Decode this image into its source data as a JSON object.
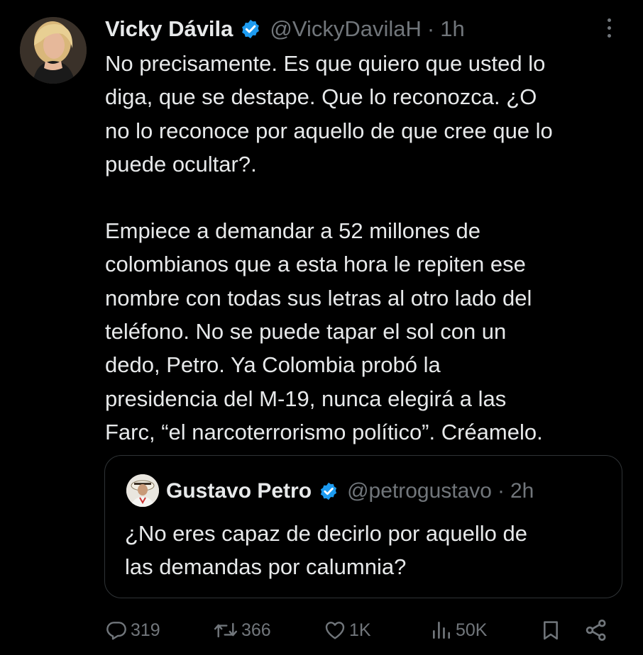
{
  "tweet": {
    "author_name": "Vicky Dávila",
    "handle": "@VickyDavilaH",
    "separator": "·",
    "time": "1h",
    "paragraph1_lines": [
      "No precisamente. Es que quiero que usted lo",
      "diga, que se destape. Que lo reconozca. ¿O",
      "no lo reconoce por aquello de que cree que lo",
      "puede ocultar?."
    ],
    "paragraph2_lines": [
      "Empiece a demandar a 52 millones de",
      "colombianos que a esta hora le repiten ese",
      "nombre con todas sus letras al otro lado del",
      "teléfono. No se puede tapar el sol con un",
      "dedo, Petro. Ya Colombia probó la",
      "presidencia del M-19, nunca elegirá a las",
      "Farc, “el narcoterrorismo político”. Créamelo."
    ]
  },
  "quoted": {
    "author_name": "Gustavo Petro",
    "handle": "@petrogustavo",
    "separator": "·",
    "time": "2h",
    "lines": [
      "¿No eres capaz de decirlo por aquello de",
      "las demandas por calumnia?"
    ]
  },
  "actions": {
    "replies": "319",
    "reposts": "366",
    "likes": "1K",
    "views": "50K"
  },
  "colors": {
    "background": "#000000",
    "text": "#e7e9ea",
    "muted": "#71767b",
    "verified": "#1d9bf0",
    "border": "#2f3336"
  },
  "icons": [
    "verified-badge-icon",
    "more-icon",
    "reply-icon",
    "repost-icon",
    "like-icon",
    "views-icon",
    "bookmark-icon",
    "share-icon"
  ]
}
